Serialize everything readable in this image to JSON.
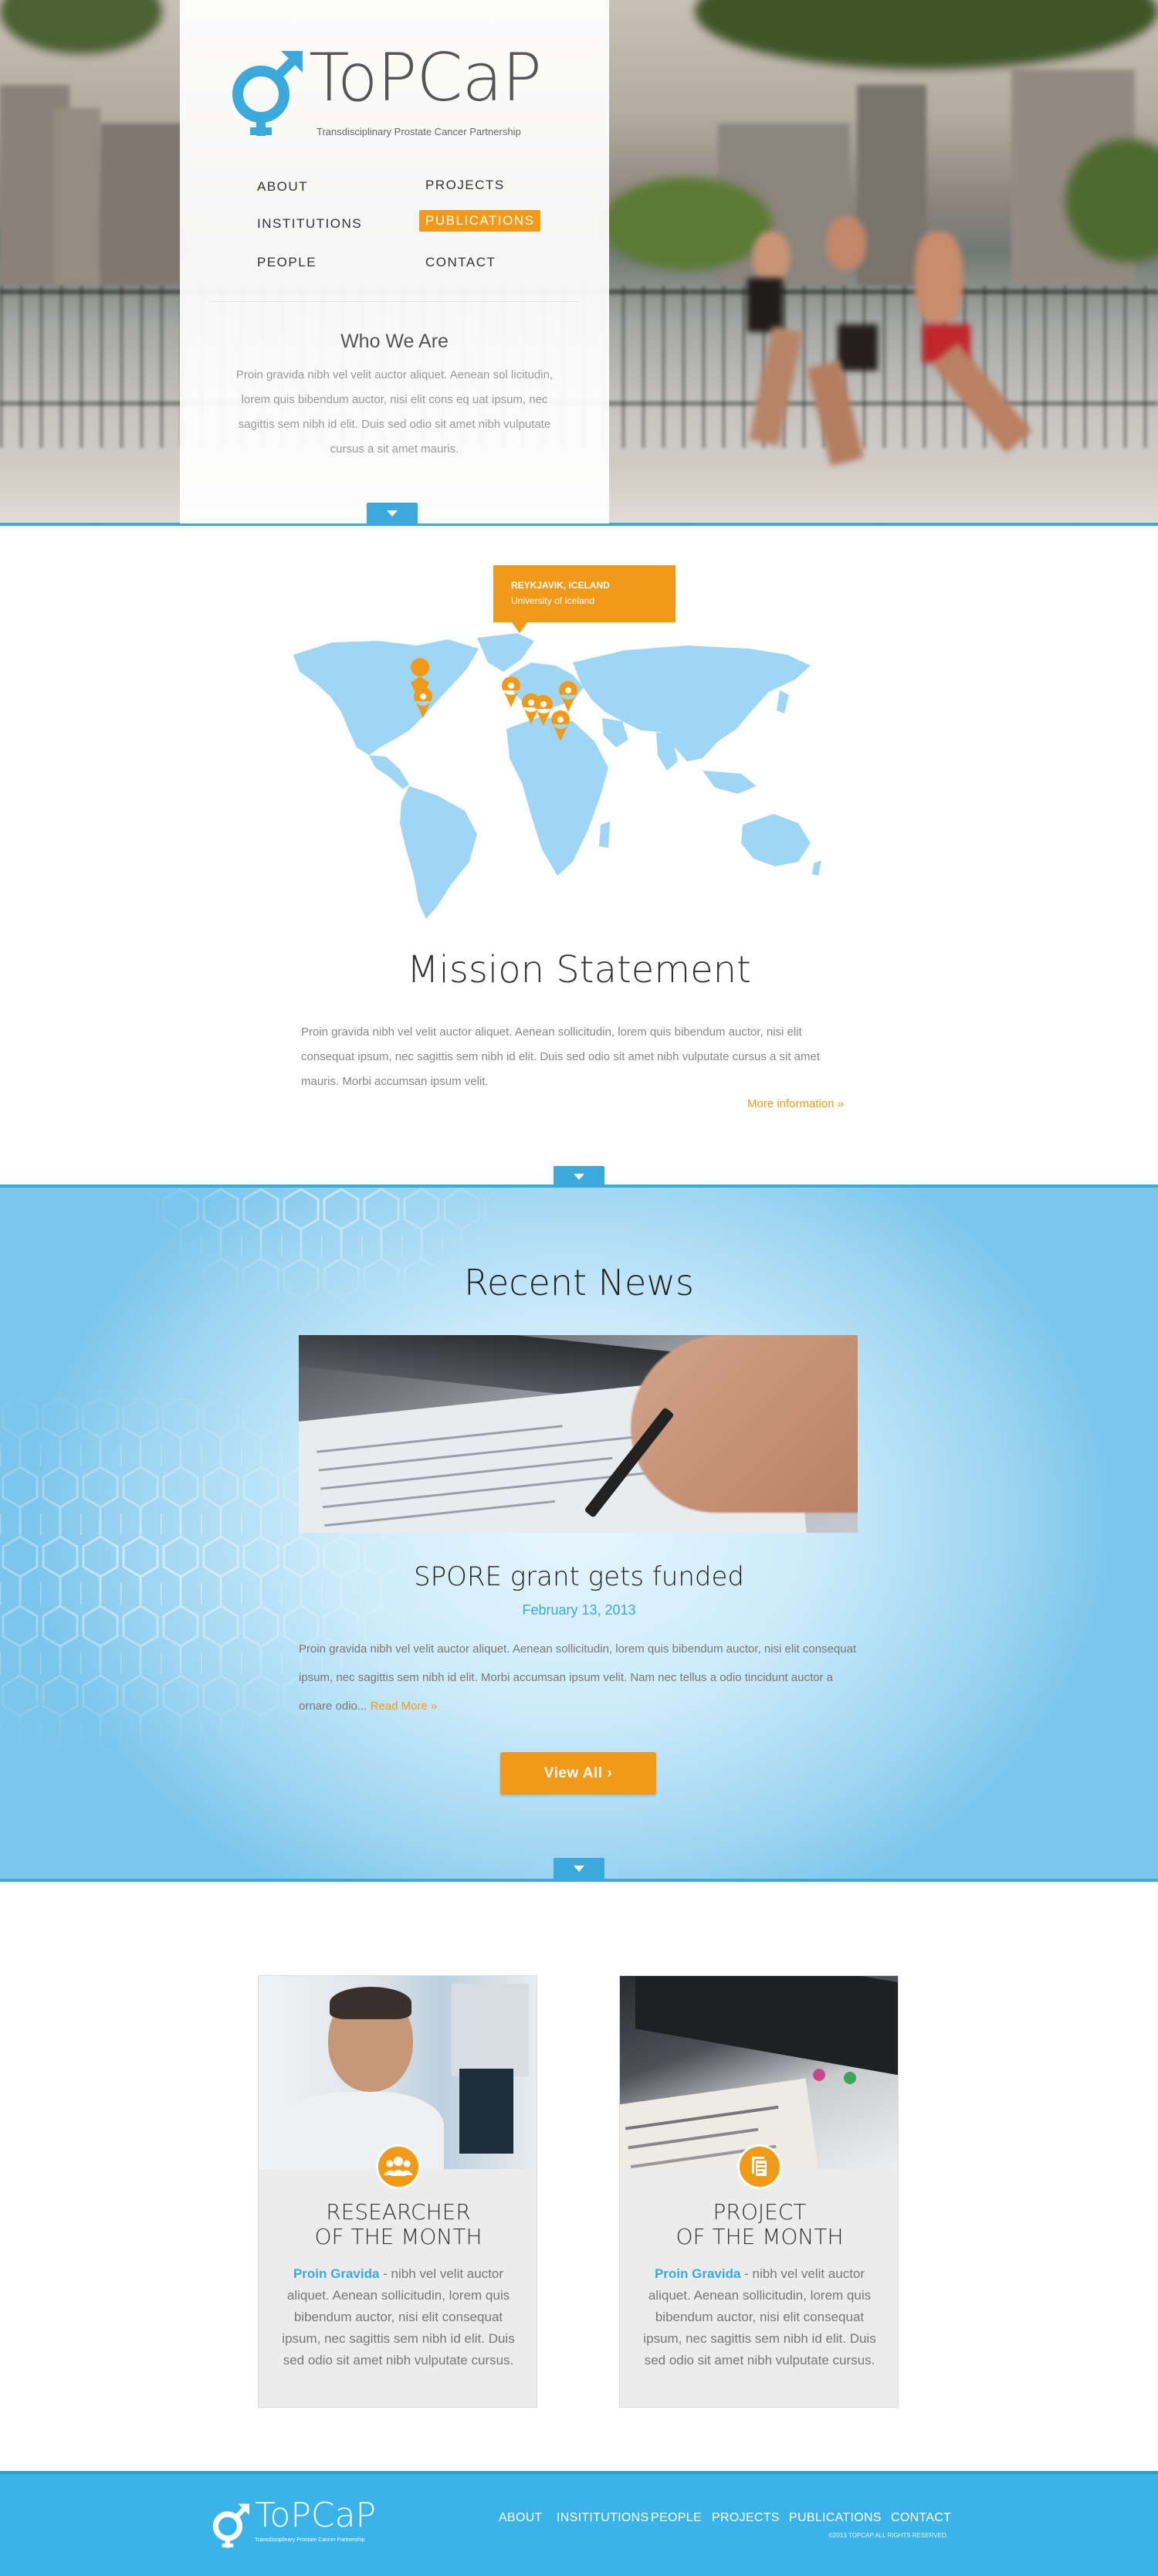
{
  "brand": {
    "name": "ToPCaP",
    "tagline": "Transdisciplinary Prostate Cancer Partnership",
    "blue": "#3aa9dc",
    "orange": "#f19a1a"
  },
  "nav": {
    "items": [
      {
        "label": "ABOUT"
      },
      {
        "label": "PROJECTS"
      },
      {
        "label": "INSTITUTIONS"
      },
      {
        "label": "PUBLICATIONS",
        "active": true
      },
      {
        "label": "PEOPLE"
      },
      {
        "label": "CONTACT"
      }
    ]
  },
  "who": {
    "title": "Who We Are",
    "text": "Proin gravida nibh vel velit auctor aliquet. Aenean sol licitudin, lorem quis bibendum auctor, nisi elit cons eq uat ipsum, nec sagittis sem nibh id elit. Duis sed odio sit amet nibh vulputate cursus a sit amet mauris."
  },
  "map": {
    "popup_city": "REYKJAVIK, ICELAND",
    "popup_institution": "University of Iceland",
    "marker_icon": "map-pin-icon"
  },
  "mission": {
    "title": "Mission Statement",
    "text": "Proin gravida nibh vel velit auctor aliquet. Aenean sollicitudin, lorem quis bibendum auctor, nisi elit consequat ipsum, nec sagittis sem nibh id elit. Duis sed odio sit amet nibh vulputate cursus a sit amet mauris. Morbi accumsan ipsum velit.",
    "more_link": "More information »"
  },
  "news": {
    "title": "Recent News",
    "story_title": "SPORE grant gets funded",
    "story_date": "February 13, 2013",
    "story_text": "Proin gravida nibh vel velit auctor aliquet. Aenean sollicitudin, lorem quis bibendum auctor, nisi elit consequat ipsum, nec sagittis sem nibh id elit. Morbi accumsan ipsum velit. Nam nec tellus a odio tincidunt auctor a ornare odio...",
    "read_more": "Read More »",
    "view_all": "View All"
  },
  "cards": [
    {
      "head_line1": "RESEARCHER",
      "head_line2": "OF THE MONTH",
      "lead": "Proin Gravida",
      "text": " - nibh vel velit auctor aliquet. Aenean sollicitudin, lorem quis bibendum auctor, nisi elit consequat ipsum, nec sagittis sem nibh id elit. Duis sed odio sit amet nibh vulputate cursus.",
      "icon": "people-icon"
    },
    {
      "head_line1": "PROJECT",
      "head_line2": "OF THE MONTH",
      "lead": "Proin Gravida",
      "text": " - nibh vel velit auctor aliquet. Aenean sollicitudin, lorem quis bibendum auctor, nisi elit consequat ipsum, nec sagittis sem nibh id elit. Duis sed odio sit amet nibh vulputate cursus.",
      "icon": "document-icon"
    }
  ],
  "footer": {
    "links": [
      "ABOUT",
      "INSITITUTIONS",
      "PEOPLE",
      "PROJECTS",
      "PUBLICATIONS",
      "CONTACT"
    ],
    "copyright": "©2013 TOPCAP ALL RIGHTS RESERVED."
  }
}
